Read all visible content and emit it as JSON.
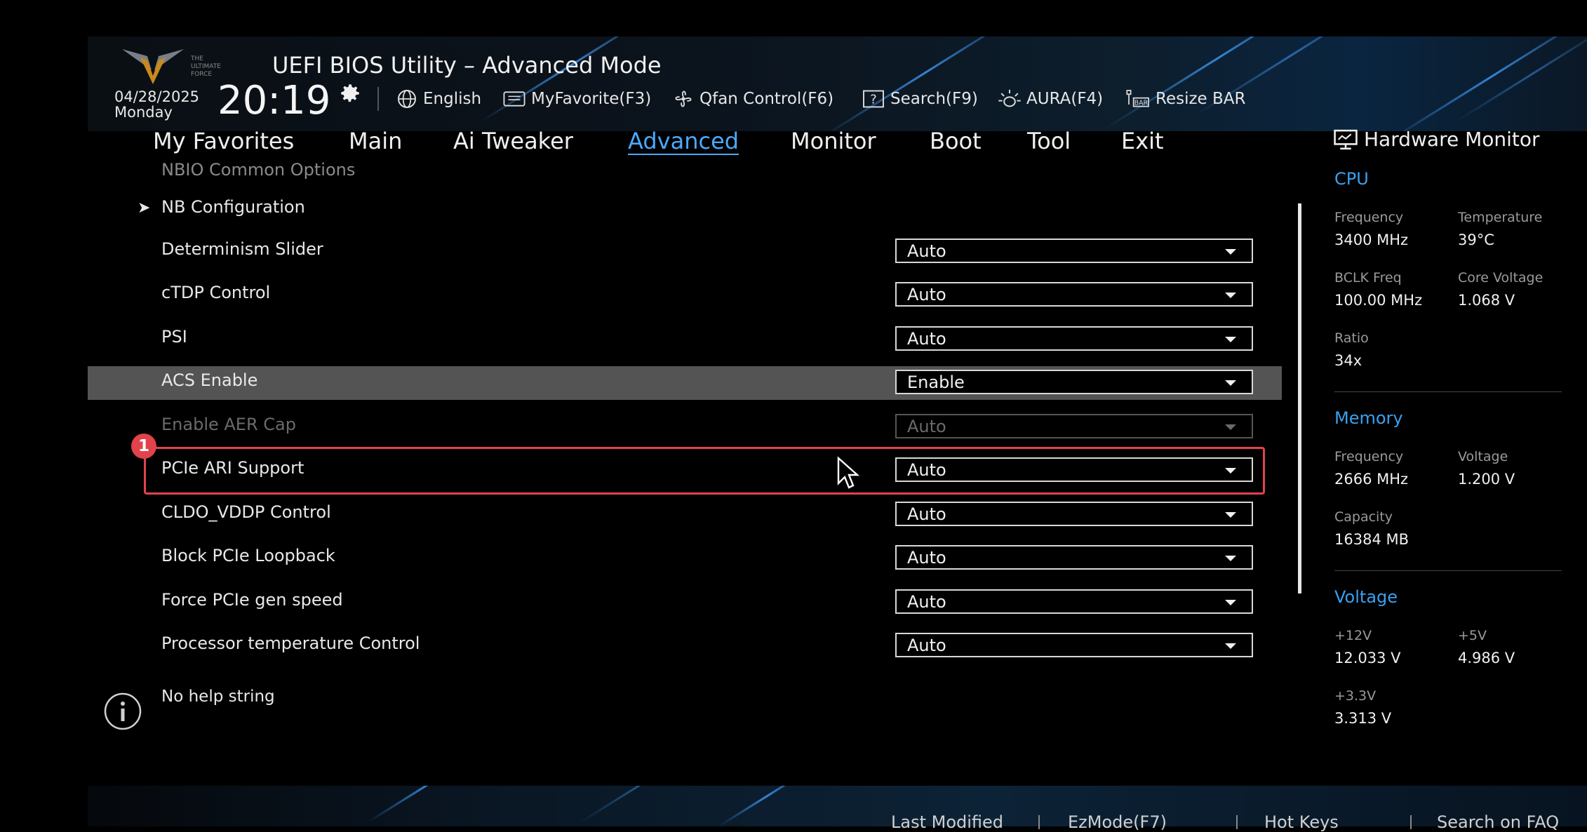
{
  "header": {
    "title": "UEFI BIOS Utility – Advanced Mode",
    "date": "04/28/2025",
    "day": "Monday",
    "time": "20:19",
    "tools": [
      {
        "label": "English",
        "icon": "globe-icon"
      },
      {
        "label": "MyFavorite(F3)",
        "icon": "favorite-icon"
      },
      {
        "label": "Qfan Control(F6)",
        "icon": "fan-icon"
      },
      {
        "label": "Search(F9)",
        "icon": "search-help-icon"
      },
      {
        "label": "AURA(F4)",
        "icon": "aura-icon"
      },
      {
        "label": "Resize BAR",
        "icon": "resize-bar-icon"
      }
    ]
  },
  "menu": {
    "tabs": [
      {
        "label": "My Favorites"
      },
      {
        "label": "Main"
      },
      {
        "label": "Ai Tweaker"
      },
      {
        "label": "Advanced",
        "active": true
      },
      {
        "label": "Monitor"
      },
      {
        "label": "Boot"
      },
      {
        "label": "Tool"
      },
      {
        "label": "Exit"
      }
    ]
  },
  "breadcrumb": "NBIO Common Options",
  "submenu": "NB Configuration",
  "settings": [
    {
      "label": "Determinism Slider",
      "value": "Auto"
    },
    {
      "label": "cTDP Control",
      "value": "Auto"
    },
    {
      "label": "PSI",
      "value": "Auto"
    },
    {
      "label": "ACS Enable",
      "value": "Enable",
      "selected": true
    },
    {
      "label": "Enable AER Cap",
      "value": "Auto",
      "disabled": true
    },
    {
      "label": "PCIe ARI Support",
      "value": "Auto",
      "highlighted": true
    },
    {
      "label": "CLDO_VDDP Control",
      "value": "Auto"
    },
    {
      "label": "Block PCIe Loopback",
      "value": "Auto"
    },
    {
      "label": "Force PCIe gen speed",
      "value": "Auto"
    },
    {
      "label": "Processor temperature Control",
      "value": "Auto"
    }
  ],
  "annotation_badge": "1",
  "help_text": "No help string",
  "hardware_monitor": {
    "title": "Hardware Monitor",
    "cpu": {
      "section": "CPU",
      "frequency_label": "Frequency",
      "frequency": "3400 MHz",
      "temperature_label": "Temperature",
      "temperature": "39°C",
      "bclk_label": "BCLK Freq",
      "bclk": "100.00 MHz",
      "core_voltage_label": "Core Voltage",
      "core_voltage": "1.068 V",
      "ratio_label": "Ratio",
      "ratio": "34x"
    },
    "memory": {
      "section": "Memory",
      "frequency_label": "Frequency",
      "frequency": "2666 MHz",
      "voltage_label": "Voltage",
      "voltage": "1.200 V",
      "capacity_label": "Capacity",
      "capacity": "16384 MB"
    },
    "voltage": {
      "section": "Voltage",
      "v12_label": "+12V",
      "v12": "12.033 V",
      "v5_label": "+5V",
      "v5": "4.986 V",
      "v33_label": "+3.3V",
      "v33": "3.313 V"
    }
  },
  "footer": {
    "items": [
      "Last Modified",
      "EzMode(F7)",
      "Hot Keys",
      "Search on FAQ"
    ]
  },
  "colors": {
    "accent": "#3aa0f0",
    "highlight_border": "#e2434b",
    "selected_row": "#545454"
  }
}
